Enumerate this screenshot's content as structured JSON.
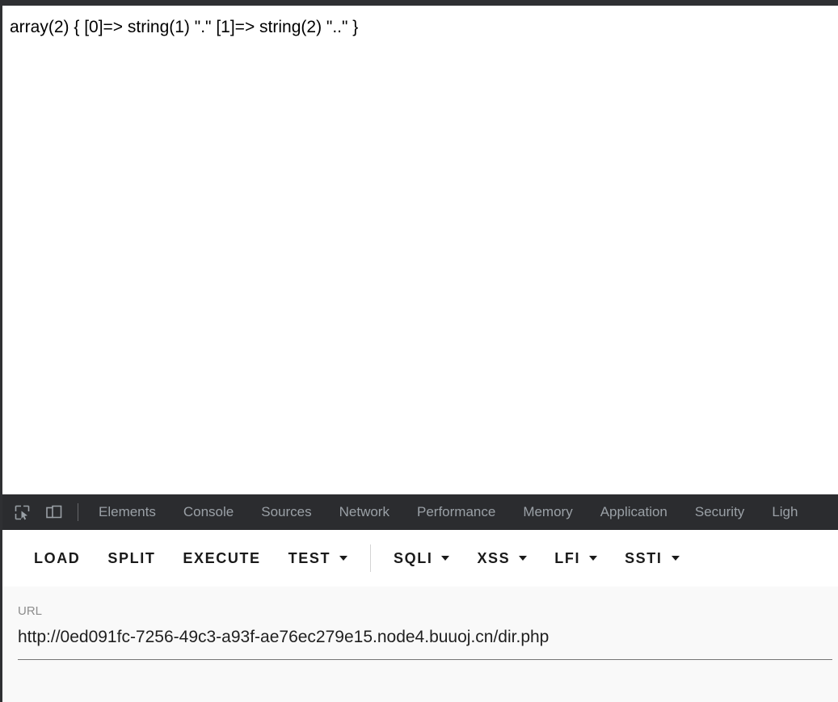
{
  "window": {
    "chrome_color": "#2f3033"
  },
  "page": {
    "output_text": "array(2) { [0]=> string(1) \".\" [1]=> string(2) \"..\" }",
    "background": "#ffffff"
  },
  "devtools": {
    "bar_color": "#2b2c2f",
    "tab_text_color": "#9aa0a6",
    "icons": [
      {
        "name": "inspect-element-icon",
        "title": "Inspect element"
      },
      {
        "name": "device-toolbar-icon",
        "title": "Toggle device toolbar"
      }
    ],
    "tabs": [
      {
        "label": "Elements"
      },
      {
        "label": "Console"
      },
      {
        "label": "Sources"
      },
      {
        "label": "Network"
      },
      {
        "label": "Performance"
      },
      {
        "label": "Memory"
      },
      {
        "label": "Application"
      },
      {
        "label": "Security"
      },
      {
        "label": "Ligh"
      }
    ]
  },
  "extension_toolbar": {
    "actions": [
      {
        "label": "LOAD",
        "has_dropdown": false
      },
      {
        "label": "SPLIT",
        "has_dropdown": false
      },
      {
        "label": "EXECUTE",
        "has_dropdown": false
      },
      {
        "label": "TEST",
        "has_dropdown": true
      }
    ],
    "payloads": [
      {
        "label": "SQLI",
        "has_dropdown": true
      },
      {
        "label": "XSS",
        "has_dropdown": true
      },
      {
        "label": "LFI",
        "has_dropdown": true
      },
      {
        "label": "SSTI",
        "has_dropdown": true
      }
    ]
  },
  "url_panel": {
    "background": "#f9f9f9",
    "label": "URL",
    "value": "http://0ed091fc-7256-49c3-a93f-ae76ec279e15.node4.buuoj.cn/dir.php",
    "placeholder": "URL",
    "underline_color": "#757575"
  }
}
